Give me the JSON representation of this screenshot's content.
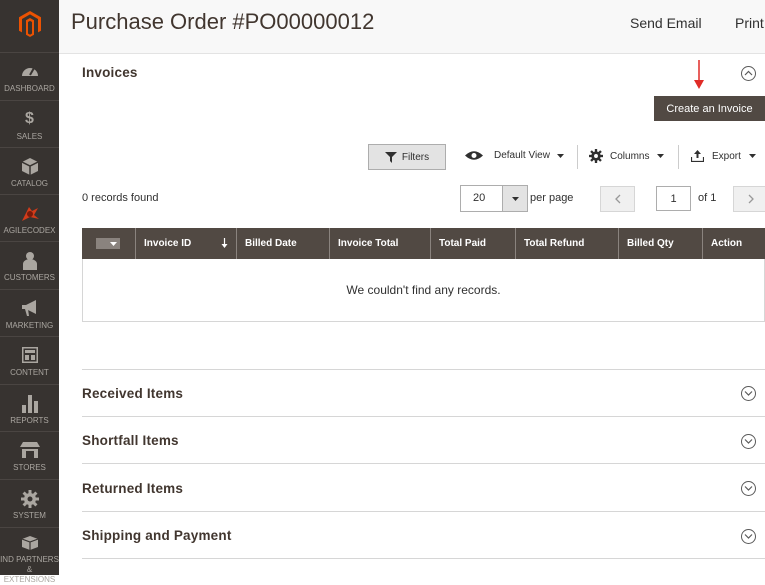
{
  "sidebar": {
    "items": [
      {
        "label": "DASHBOARD",
        "icon": "dashboard-icon"
      },
      {
        "label": "SALES",
        "icon": "dollar-icon"
      },
      {
        "label": "CATALOG",
        "icon": "cube-icon"
      },
      {
        "label": "AGILECODEX",
        "icon": "agilecodex-icon"
      },
      {
        "label": "CUSTOMERS",
        "icon": "person-icon"
      },
      {
        "label": "MARKETING",
        "icon": "megaphone-icon"
      },
      {
        "label": "CONTENT",
        "icon": "content-icon"
      },
      {
        "label": "REPORTS",
        "icon": "bar-chart-icon"
      },
      {
        "label": "STORES",
        "icon": "store-icon"
      },
      {
        "label": "SYSTEM",
        "icon": "gear-icon"
      },
      {
        "label": "IND PARTNERS & EXTENSIONS",
        "icon": "box-icon"
      }
    ]
  },
  "header": {
    "title": "Purchase Order #PO00000012",
    "send_email": "Send Email",
    "print": "Print"
  },
  "invoices": {
    "title": "Invoices",
    "create_button": "Create an Invoice",
    "filters": "Filters",
    "default_view": "Default View",
    "columns": "Columns",
    "export": "Export",
    "records_found": "0 records found",
    "per_page_value": "20",
    "per_page_label": "per page",
    "current_page": "1",
    "of_pages": "of 1",
    "columns_list": [
      "Invoice ID",
      "Billed Date",
      "Invoice Total",
      "Total Paid",
      "Total Refund",
      "Billed Qty",
      "Action"
    ],
    "empty_message": "We couldn't find any records."
  },
  "sections": {
    "received": "Received Items",
    "shortfall": "Shortfall Items",
    "returned": "Returned Items",
    "shipping": "Shipping and Payment"
  },
  "colors": {
    "sidebar_bg": "#373330",
    "brand_orange": "#eb5202",
    "dark_button": "#514943",
    "arrow_red": "#e02b27"
  }
}
